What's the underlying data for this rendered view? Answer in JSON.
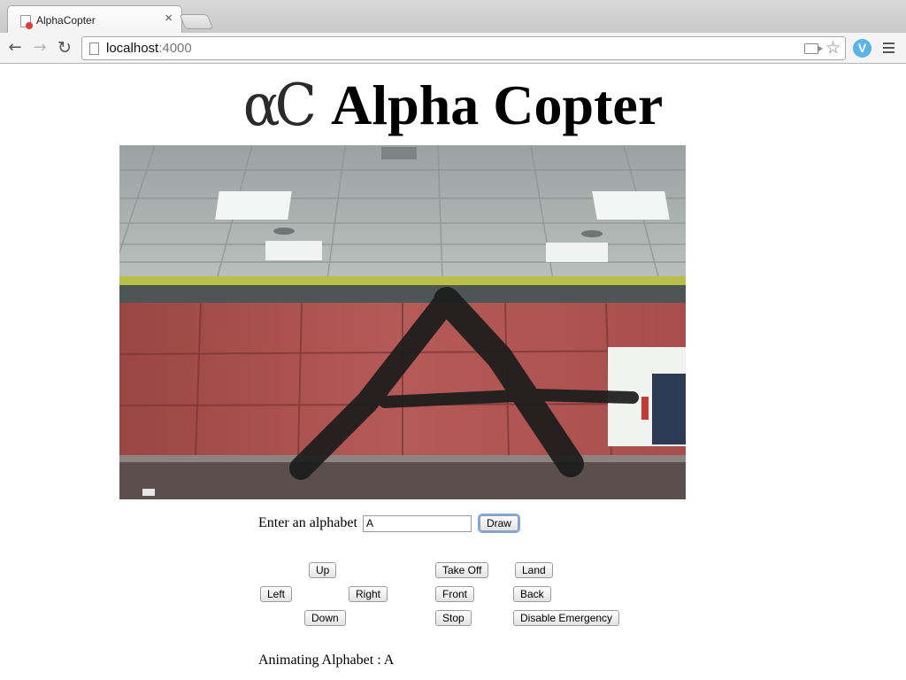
{
  "browser": {
    "tab_title": "AlphaCopter",
    "tab_close": "×",
    "url_host": "localhost",
    "url_port": ":4000",
    "ext_label": "V"
  },
  "header": {
    "logo_text": "αC",
    "title": "Alpha Copter"
  },
  "draw_form": {
    "label": "Enter an alphabet",
    "input_value": "A",
    "draw_label": "Draw"
  },
  "controls": {
    "up": "Up",
    "left": "Left",
    "right": "Right",
    "down": "Down",
    "take_off": "Take Off",
    "land": "Land",
    "front": "Front",
    "back": "Back",
    "stop": "Stop",
    "disable_emergency": "Disable Emergency"
  },
  "status": {
    "text": "Animating Alphabet : A"
  }
}
